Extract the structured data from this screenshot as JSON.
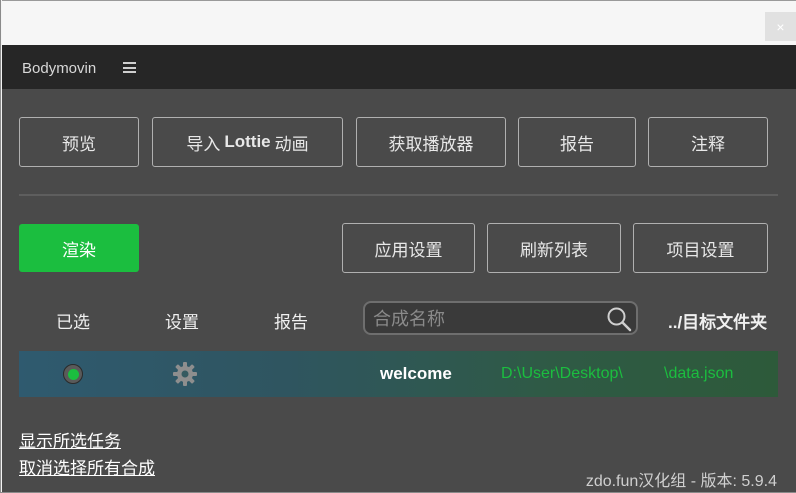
{
  "window": {
    "close_glyph": "×"
  },
  "header": {
    "title": "Bodymovin",
    "menu_icon": "hamburger-menu-icon"
  },
  "toolbar_top": {
    "preview": "预览",
    "import_prefix": "导入",
    "import_bold": "Lottie",
    "import_suffix": "动画",
    "get_player": "获取播放器",
    "report": "报告",
    "annotations": "注释"
  },
  "toolbar_second": {
    "render": "渲染",
    "app_settings": "应用设置",
    "refresh_list": "刷新列表",
    "project_settings": "项目设置"
  },
  "columns": {
    "selected": "已选",
    "settings": "设置",
    "report": "报告",
    "search_placeholder": "合成名称",
    "destination": "../目标文件夹"
  },
  "compositions": [
    {
      "selected": true,
      "name": "welcome",
      "dest_path": "D:\\User\\Desktop\\",
      "dest_file": "\\data.json"
    }
  ],
  "footer": {
    "show_selected": "显示所选任务",
    "deselect_all": "取消选择所有合成",
    "version": "zdo.fun汉化组 - 版本: 5.9.4"
  },
  "colors": {
    "accent_green": "#1bbe3f",
    "panel_bg": "#4a4a4a",
    "header_bg": "#262626"
  }
}
